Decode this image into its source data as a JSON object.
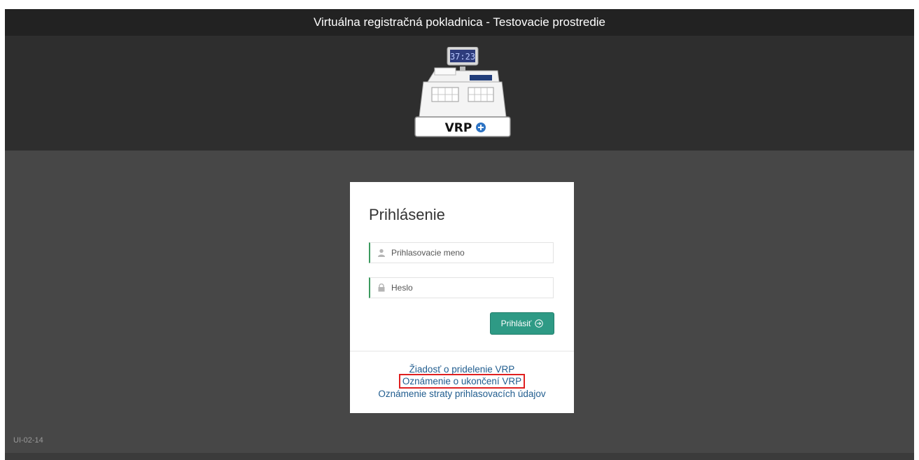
{
  "window": {
    "title": "Virtuálna registračná pokladnica - Testovacie prostredie"
  },
  "logo": {
    "display_time": "37:23",
    "brand": "VRP"
  },
  "login": {
    "heading": "Prihlásenie",
    "username_placeholder": "Prihlasovacie meno",
    "password_placeholder": "Heslo",
    "submit_label": "Prihlásiť"
  },
  "links": {
    "request": "Žiadosť o pridelenie VRP",
    "termination": "Oznámenie o ukončení VRP",
    "lost_credentials": "Oznámenie straty prihlasovacích údajov"
  },
  "footer": {
    "version": "UI-02-14"
  },
  "colors": {
    "accent": "#2e9a85",
    "link": "#215d8f",
    "highlight": "#e02020",
    "field_border": "#3c9a5f"
  },
  "icons": {
    "username": "user-icon",
    "password": "lock-icon",
    "submit": "arrow-circle-right-icon"
  }
}
